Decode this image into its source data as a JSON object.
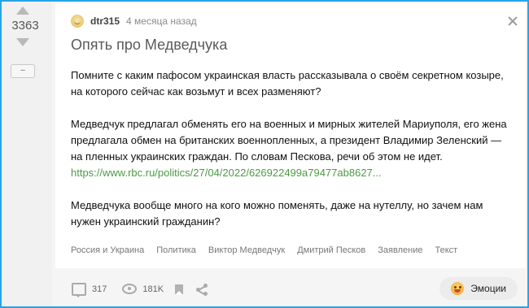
{
  "vote": {
    "rating": "3363",
    "collapse_label": "–"
  },
  "post": {
    "author": "dtr315",
    "time": "4 месяца назад",
    "title": "Опять про Медведчука",
    "paragraphs": [
      "Помните с каким пафосом украинская власть рассказывала о своём секретном козыре, на которого сейчас как возьмут и всех разменяют?",
      "Медведчук предлагал обменять его на военных и мирных жителей Мариуполя, его жена предлагала обмен на британских военнопленных, а президент Владимир Зеленский — на пленных украинских граждан. По словам Пескова, речи об этом не идет.",
      "Медведчука вообще много на кого можно поменять, даже на нутеллу, но зачем нам нужен украинский гражданин?"
    ],
    "link_text": "https://www.rbc.ru/politics/27/04/2022/626922499a79477ab8627...",
    "tags": [
      "Россия и Украина",
      "Политика",
      "Виктор Медведчук",
      "Дмитрий Песков",
      "Заявление",
      "Текст"
    ]
  },
  "footer": {
    "comments": "317",
    "views": "181K",
    "emotions_label": "Эмоции"
  },
  "colors": {
    "frame": "#2aa3e6",
    "link": "#4b9a43"
  }
}
